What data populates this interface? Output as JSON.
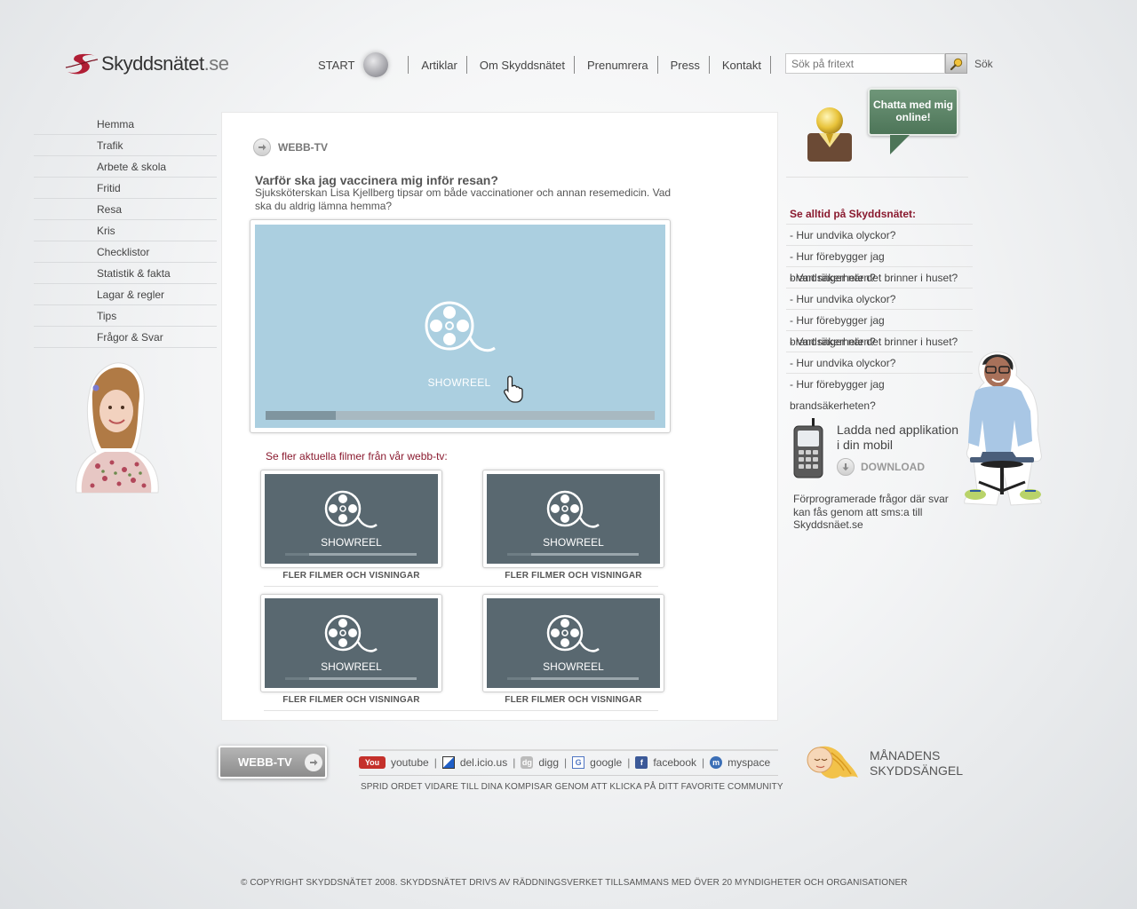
{
  "header": {
    "logo_text": "Skyddsnätet",
    "logo_tld": ".se",
    "nav": {
      "start": "START",
      "items": [
        "Artiklar",
        "Om Skyddsnätet",
        "Prenumrera",
        "Press",
        "Kontakt"
      ]
    },
    "search": {
      "placeholder": "Sök på fritext",
      "button_label": "Sök"
    }
  },
  "sidebar": {
    "items": [
      "Hemma",
      "Trafik",
      "Arbete & skola",
      "Fritid",
      "Resa",
      "Kris",
      "Checklistor",
      "Statistik & fakta",
      "Lagar & regler",
      "Tips",
      "Frågor & Svar"
    ]
  },
  "main": {
    "section_title": "WEBB-TV",
    "question_title": "Varför ska jag vaccinera mig inför resan?",
    "question_text": "Sjuksköterskan Lisa Kjellberg tipsar om både vaccinationer och annan resemedicin. Vad ska du aldrig lämna hemma?",
    "player": {
      "label": "SHOWREEL",
      "progress": 0.18
    },
    "more_label": "Se fler aktuella filmer från vår webb-tv:",
    "thumbnails": [
      {
        "label": "SHOWREEL",
        "caption": "FLER FILMER OCH VISNINGAR",
        "progress": 0.18
      },
      {
        "label": "SHOWREEL",
        "caption": "FLER FILMER OCH VISNINGAR",
        "progress": 0.18
      },
      {
        "label": "SHOWREEL",
        "caption": "FLER FILMER OCH VISNINGAR",
        "progress": 0.18
      },
      {
        "label": "SHOWREEL",
        "caption": "FLER FILMER OCH VISNINGAR",
        "progress": 0.18
      }
    ]
  },
  "right": {
    "chat_label": "Chatta med mig online!",
    "see_title": "Se alltid på Skyddsnätet:",
    "links": [
      "- Hur undvika olyckor?",
      "- Hur förebygger jag brandsäkerheten?",
      "- Vart ringer när det brinner i huset?",
      "- Hur undvika olyckor?",
      "- Hur förebygger jag brandsäkerheten?",
      "- Vart ringer när det brinner i huset?",
      "- Hur undvika olyckor?",
      "- Hur förebygger jag brandsäkerheten?"
    ],
    "app": {
      "title_line1": "Ladda ned applikation",
      "title_line2": "i din mobil",
      "download_label": "DOWNLOAD",
      "description": "Förprogramerade frågor där svar kan fås genom att sms:a till Skyddsnäet.se"
    }
  },
  "footer": {
    "webbtv_button": "WEBB-TV",
    "social": [
      {
        "name": "youtube",
        "icon": "youtube-icon",
        "color": "#c4302b"
      },
      {
        "name": "del.icio.us",
        "icon": "delicious-icon",
        "color": "#1f5fc7"
      },
      {
        "name": "digg",
        "icon": "digg-icon",
        "color": "#9a9a9a"
      },
      {
        "name": "google",
        "icon": "google-icon",
        "color": "#4f75c2"
      },
      {
        "name": "facebook",
        "icon": "facebook-icon",
        "color": "#3b5998"
      },
      {
        "name": "myspace",
        "icon": "myspace-icon",
        "color": "#3b6fb6"
      }
    ],
    "spread_text": "SPRID ORDET VIDARE TILL DINA KOMPISAR GENOM ATT KLICKA PÅ DITT FAVORITE COMMUNITY",
    "angel_line1": "MÅNADENS",
    "angel_line2": "SKYDDSÄNGEL",
    "copyright": "© COPYRIGHT SKYDDSNÄTET 2008. SKYDDSNÄTET DRIVS AV RÄDDNINGSVERKET TILLSAMMANS MED ÖVER 20 MYNDIGHETER OCH ORGANISATIONER"
  },
  "colors": {
    "accent": "#8a1a2f",
    "player_bg": "#abcfe0",
    "thumb_bg": "#596870",
    "chat_green": "#5a8264"
  }
}
